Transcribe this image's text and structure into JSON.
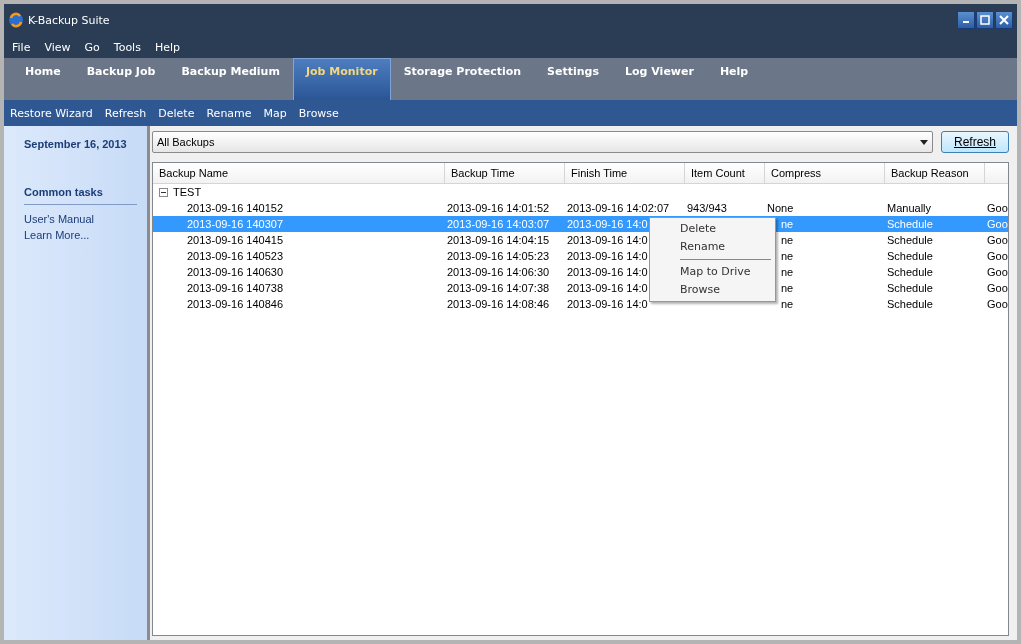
{
  "window": {
    "title": "K-Backup Suite"
  },
  "menu_bar": [
    "File",
    "View",
    "Go",
    "Tools",
    "Help"
  ],
  "tabs": [
    {
      "label": "Home",
      "selected": false
    },
    {
      "label": "Backup Job",
      "selected": false
    },
    {
      "label": "Backup Medium",
      "selected": false
    },
    {
      "label": "Job Monitor",
      "selected": true
    },
    {
      "label": "Storage Protection",
      "selected": false
    },
    {
      "label": "Settings",
      "selected": false
    },
    {
      "label": "Log Viewer",
      "selected": false
    },
    {
      "label": "Help",
      "selected": false
    }
  ],
  "toolbar": [
    "Restore Wizard",
    "Refresh",
    "Delete",
    "Rename",
    "Map",
    "Browse"
  ],
  "sidebar": {
    "date": "September 16, 2013",
    "section_title": "Common tasks",
    "links": [
      "User's Manual",
      "Learn More..."
    ]
  },
  "filter": {
    "value": "All Backups",
    "button": "Refresh"
  },
  "table": {
    "columns": [
      "Backup Name",
      "Backup Time",
      "Finish Time",
      "Item Count",
      "Compress",
      "Backup Reason"
    ],
    "group": {
      "label": "TEST",
      "expanded": true
    },
    "rows": [
      {
        "selected": false,
        "cells": [
          "2013-09-16 140152",
          "2013-09-16 14:01:52",
          "2013-09-16 14:02:07",
          "943/943",
          "None",
          "Manually",
          "Goo"
        ]
      },
      {
        "selected": true,
        "cells": [
          "2013-09-16 140307",
          "2013-09-16 14:03:07",
          "2013-09-16 14:0",
          "",
          "ne",
          "Schedule",
          "Goo"
        ]
      },
      {
        "selected": false,
        "cells": [
          "2013-09-16 140415",
          "2013-09-16 14:04:15",
          "2013-09-16 14:0",
          "",
          "ne",
          "Schedule",
          "Goo"
        ]
      },
      {
        "selected": false,
        "cells": [
          "2013-09-16 140523",
          "2013-09-16 14:05:23",
          "2013-09-16 14:0",
          "",
          "ne",
          "Schedule",
          "Goo"
        ]
      },
      {
        "selected": false,
        "cells": [
          "2013-09-16 140630",
          "2013-09-16 14:06:30",
          "2013-09-16 14:0",
          "",
          "ne",
          "Schedule",
          "Goo"
        ]
      },
      {
        "selected": false,
        "cells": [
          "2013-09-16 140738",
          "2013-09-16 14:07:38",
          "2013-09-16 14:0",
          "",
          "ne",
          "Schedule",
          "Goo"
        ]
      },
      {
        "selected": false,
        "cells": [
          "2013-09-16 140846",
          "2013-09-16 14:08:46",
          "2013-09-16 14:0",
          "",
          "ne",
          "Schedule",
          "Goo"
        ]
      }
    ]
  },
  "context_menu": [
    {
      "label": "Delete",
      "kind": "item"
    },
    {
      "label": "Rename",
      "kind": "item"
    },
    {
      "kind": "separator"
    },
    {
      "label": "Map to Drive",
      "kind": "item"
    },
    {
      "label": "Browse",
      "kind": "item"
    }
  ]
}
